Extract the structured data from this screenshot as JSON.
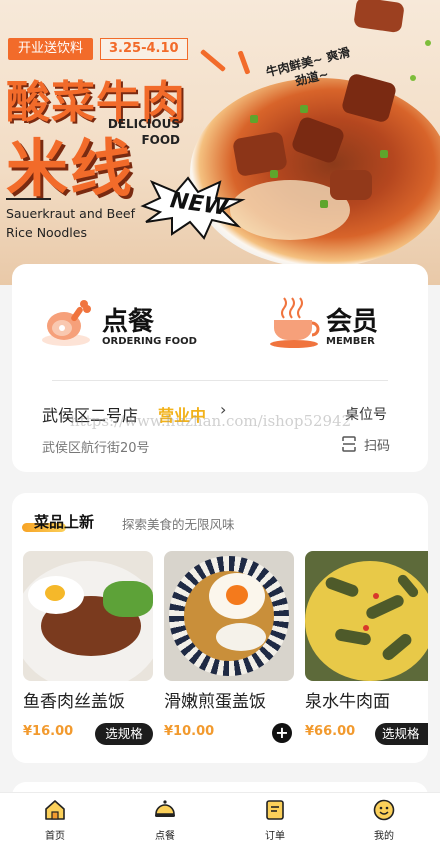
{
  "banner": {
    "promo_tag": "开业送饮料",
    "promo_date": "3.25-4.10",
    "title_line1": "酸菜牛肉",
    "title_line2": "米线",
    "delicious_label": "DELICIOUS FOOD",
    "title_en": "Sauerkraut and Beef Rice Noodles",
    "slogan": "牛肉鲜美~ 爽滑劲道~",
    "new_badge": "NEW"
  },
  "actions": {
    "order": {
      "label_cn": "点餐",
      "label_en": "ORDERING FOOD",
      "icon": "ham-drumstick-icon"
    },
    "member": {
      "label_cn": "会员",
      "label_en": "MEMBER",
      "icon": "coffee-cup-icon"
    }
  },
  "store": {
    "name": "武侯区二号店",
    "status": "营业中",
    "address": "武侯区航行街20号",
    "table_label": "桌位号",
    "scan_label": "扫码"
  },
  "watermark": "https://www.huzhan.com/ishop52942",
  "dishes_section": {
    "title": "菜品上新",
    "subtitle": "探索美食的无限风味",
    "items": [
      {
        "name": "鱼香肉丝盖饭",
        "price": "¥16.00",
        "action": "选规格"
      },
      {
        "name": "滑嫩煎蛋盖饭",
        "price": "¥10.00",
        "action": "+"
      },
      {
        "name": "泉水牛肉面",
        "price": "¥66.00",
        "action": "选规格"
      }
    ]
  },
  "tabbar": [
    {
      "label": "首页",
      "icon": "home-icon"
    },
    {
      "label": "点餐",
      "icon": "food-cloche-icon"
    },
    {
      "label": "订单",
      "icon": "order-list-icon"
    },
    {
      "label": "我的",
      "icon": "smiley-face-icon"
    }
  ],
  "colors": {
    "accent_orange": "#f26b2a",
    "status_yellow": "#f2b21a",
    "price_orange": "#f29a2e",
    "button_dark": "#1d1d1d"
  }
}
